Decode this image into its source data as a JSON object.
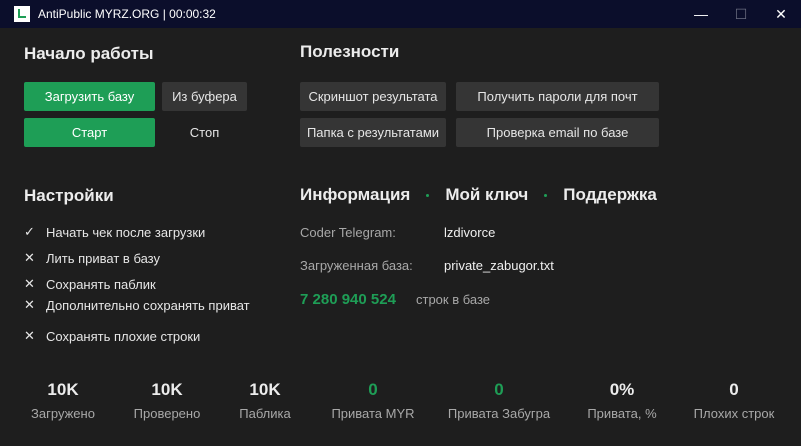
{
  "window": {
    "title": "AntiPublic MYRZ.ORG | 00:00:32",
    "minimize": "—",
    "maximize": "☐",
    "close": "✕"
  },
  "start": {
    "title": "Начало работы",
    "load_base": "Загрузить базу",
    "from_clipboard": "Из буфера",
    "start": "Старт",
    "stop": "Стоп"
  },
  "tools": {
    "title": "Полезности",
    "screenshot": "Скриншот результата",
    "get_passwords": "Получить пароли для почт",
    "results_folder": "Папка с результатами",
    "check_email": "Проверка email по базе"
  },
  "settings": {
    "title": "Настройки",
    "items": [
      {
        "mark": "✓",
        "label": "Начать чек после загрузки",
        "checked": true
      },
      {
        "mark": "✕",
        "label": "Лить приват в базу",
        "checked": false
      },
      {
        "mark": "✕",
        "label": "Сохранять паблик",
        "checked": false
      },
      {
        "mark": "✕",
        "label": "Дополнительно сохранять приват",
        "checked": false
      },
      {
        "mark": "✕",
        "label": "Сохранять плохие строки",
        "checked": false
      }
    ]
  },
  "info": {
    "tabs": [
      "Информация",
      "Мой ключ",
      "Поддержка"
    ],
    "telegram_label": "Coder Telegram:",
    "telegram_value": "lzdivorce",
    "base_label": "Загруженная база:",
    "base_value": "private_zabugor.txt",
    "lines_count": "7 280 940 524",
    "lines_label": "строк в базе"
  },
  "stats": [
    {
      "value": "10K",
      "label": "Загружено",
      "accent": false
    },
    {
      "value": "10K",
      "label": "Проверено",
      "accent": false
    },
    {
      "value": "10K",
      "label": "Паблика",
      "accent": false
    },
    {
      "value": "0",
      "label": "Привата MYR",
      "accent": true
    },
    {
      "value": "0",
      "label": "Привата Забугра",
      "accent": true
    },
    {
      "value": "0%",
      "label": "Привата, %",
      "accent": false
    },
    {
      "value": "0",
      "label": "Плохих строк",
      "accent": false
    }
  ],
  "colors": {
    "accent": "#1e9e56",
    "background": "#1e1e1e",
    "titlebar": "#0b0e2b",
    "button": "#353535"
  }
}
